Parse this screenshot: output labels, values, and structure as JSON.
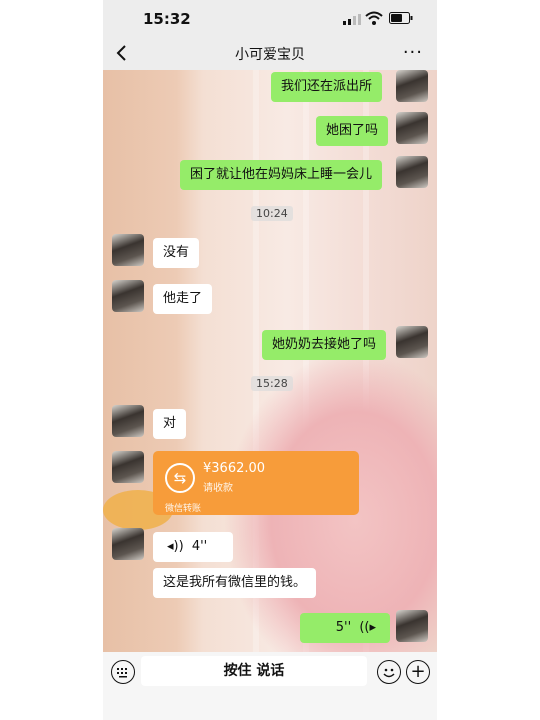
{
  "status": {
    "time": "15:32"
  },
  "nav": {
    "title": "小可爱宝贝",
    "more": "···"
  },
  "messages": {
    "m1": "我们还在派出所",
    "m2": "她困了吗",
    "m3": "困了就让他在妈妈床上睡一会儿",
    "m4": "没有",
    "m5": "他走了",
    "m6": "她奶奶去接她了吗",
    "m7": "对",
    "m9": "这是我所有微信里的钱。"
  },
  "timestamps": {
    "t1": "10:24",
    "t2": "15:28"
  },
  "transfer": {
    "amount": "¥3662.00",
    "desc": "请收款",
    "footer": "微信转账",
    "icon": "transfer-arrows-icon"
  },
  "voice": {
    "left_duration": "4''",
    "right_duration": "5''"
  },
  "input": {
    "hold_to_talk": "按住 说话"
  },
  "colors": {
    "green_bubble": "#95ec69",
    "transfer_orange": "#f79c3a",
    "white_bubble": "#ffffff"
  }
}
